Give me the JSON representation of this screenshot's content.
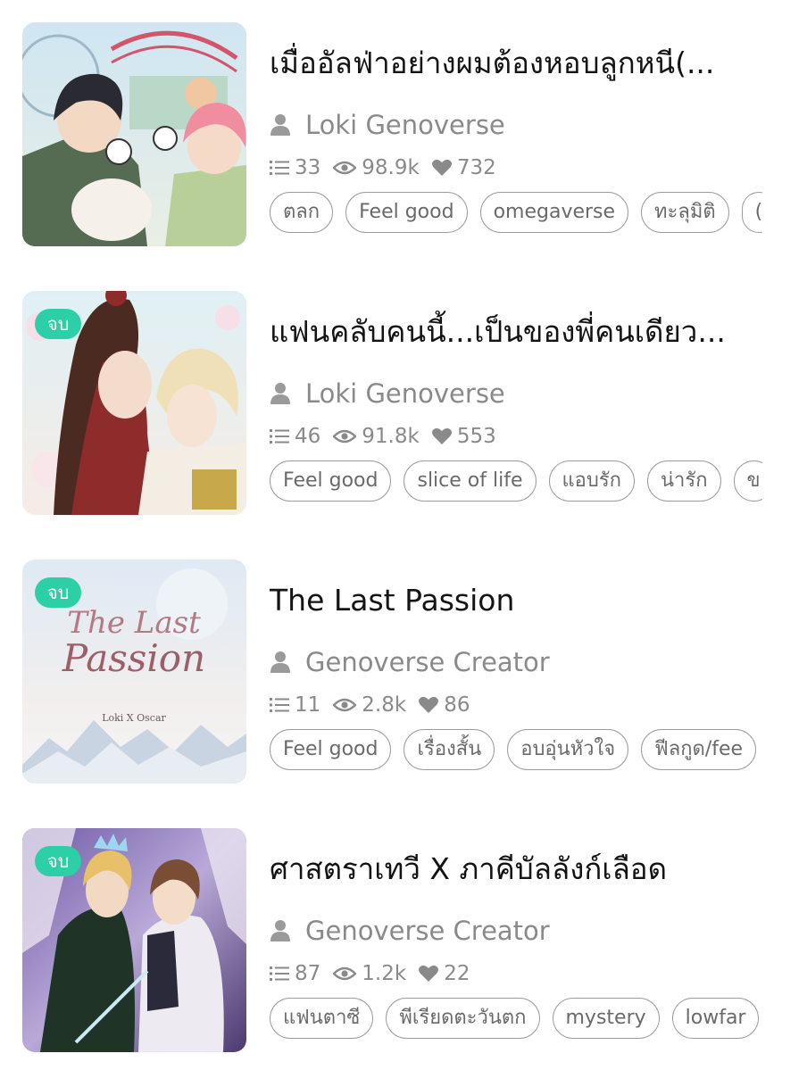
{
  "colors": {
    "badge": "#2ccfa6",
    "meta_text": "#8a8a8a",
    "tag_border": "#9c9c9c",
    "title_text": "#141414"
  },
  "icons": {
    "author": "person-icon",
    "chapters": "list-icon",
    "views": "eye-icon",
    "likes": "heart-icon"
  },
  "stories": [
    {
      "title": "เมื่ออัลฟ่าอย่างผมต้องหอบลูกหนี(...",
      "badge": "",
      "author": "Loki Genoverse",
      "chapters": "33",
      "views": "98.9k",
      "likes": "732",
      "tags": [
        "ตลก",
        "Feel good",
        "omegaverse",
        "ทะลุมิติ",
        "("
      ]
    },
    {
      "title": "แฟนคลับคนนี้...เป็นของพี่คนเดียว...",
      "badge": "จบ",
      "author": "Loki Genoverse",
      "chapters": "46",
      "views": "91.8k",
      "likes": "553",
      "tags": [
        "Feel good",
        "slice of life",
        "แอบรัก",
        "น่ารัก",
        "ข"
      ]
    },
    {
      "title": "The Last Passion",
      "badge": "จบ",
      "author": "Genoverse Creator",
      "chapters": "11",
      "views": "2.8k",
      "likes": "86",
      "cover_title_line1": "The Last",
      "cover_title_line2": "Passion",
      "cover_subtitle": "Loki X Oscar",
      "tags": [
        "Feel good",
        "เรื่องสั้น",
        "อบอุ่นหัวใจ",
        "ฟีลกูด/fee"
      ]
    },
    {
      "title": "ศาสตราเทวี X ภาคีบัลลังก์เลือด",
      "badge": "จบ",
      "author": "Genoverse Creator",
      "chapters": "87",
      "views": "1.2k",
      "likes": "22",
      "tags": [
        "แฟนตาซี",
        "พีเรียดตะวันตก",
        "mystery",
        "lowfar"
      ]
    }
  ]
}
